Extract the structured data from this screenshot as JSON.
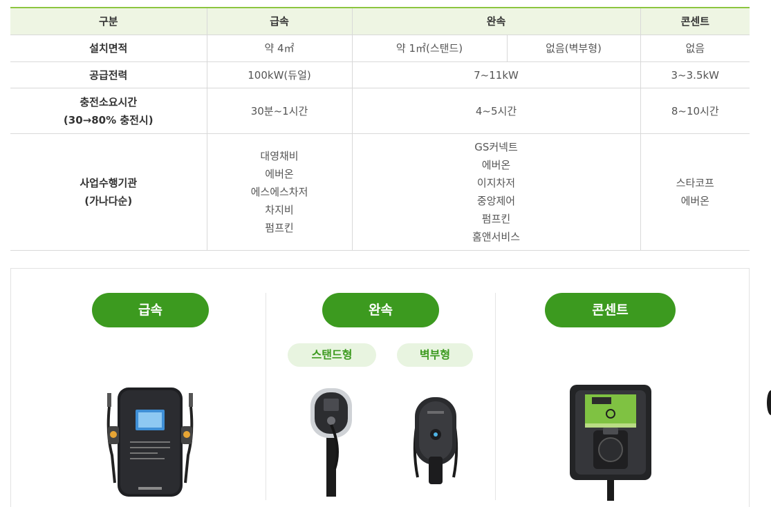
{
  "table": {
    "headers": {
      "category": "구분",
      "fast": "급속",
      "slow": "완속",
      "outlet": "콘센트"
    },
    "rows": {
      "area": {
        "label": "설치면적",
        "fast": "약 4㎡",
        "slow_stand": "약 1㎡(스탠드)",
        "slow_wall": "없음(벽부형)",
        "outlet": "없음"
      },
      "power": {
        "label": "공급전력",
        "fast": "100kW(듀얼)",
        "slow": "7~11kW",
        "outlet": "3~3.5kW"
      },
      "time": {
        "label_line1": "충전소요시간",
        "label_line2": "(30→80% 충전시)",
        "fast": "30분~1시간",
        "slow": "4~5시간",
        "outlet": "8~10시간"
      },
      "agencies": {
        "label_line1": "사업수행기관",
        "label_line2": "(가나다순)",
        "fast": [
          "대영채비",
          "에버온",
          "에스에스차저",
          "차지비",
          "펌프킨"
        ],
        "slow": [
          "GS커넥트",
          "에버온",
          "이지차저",
          "중앙제어",
          "펌프킨",
          "홈앤서비스"
        ],
        "outlet": [
          "스타코프",
          "에버온"
        ]
      }
    }
  },
  "panel": {
    "fast_label": "급속",
    "slow_label": "완속",
    "outlet_label": "콘센트",
    "stand_label": "스탠드형",
    "wall_label": "벽부형"
  },
  "colors": {
    "accent_green": "#3c9a1f",
    "header_bg": "#eef5e3",
    "header_border": "#8cc53f",
    "subpill_bg": "#e8f4e0"
  }
}
